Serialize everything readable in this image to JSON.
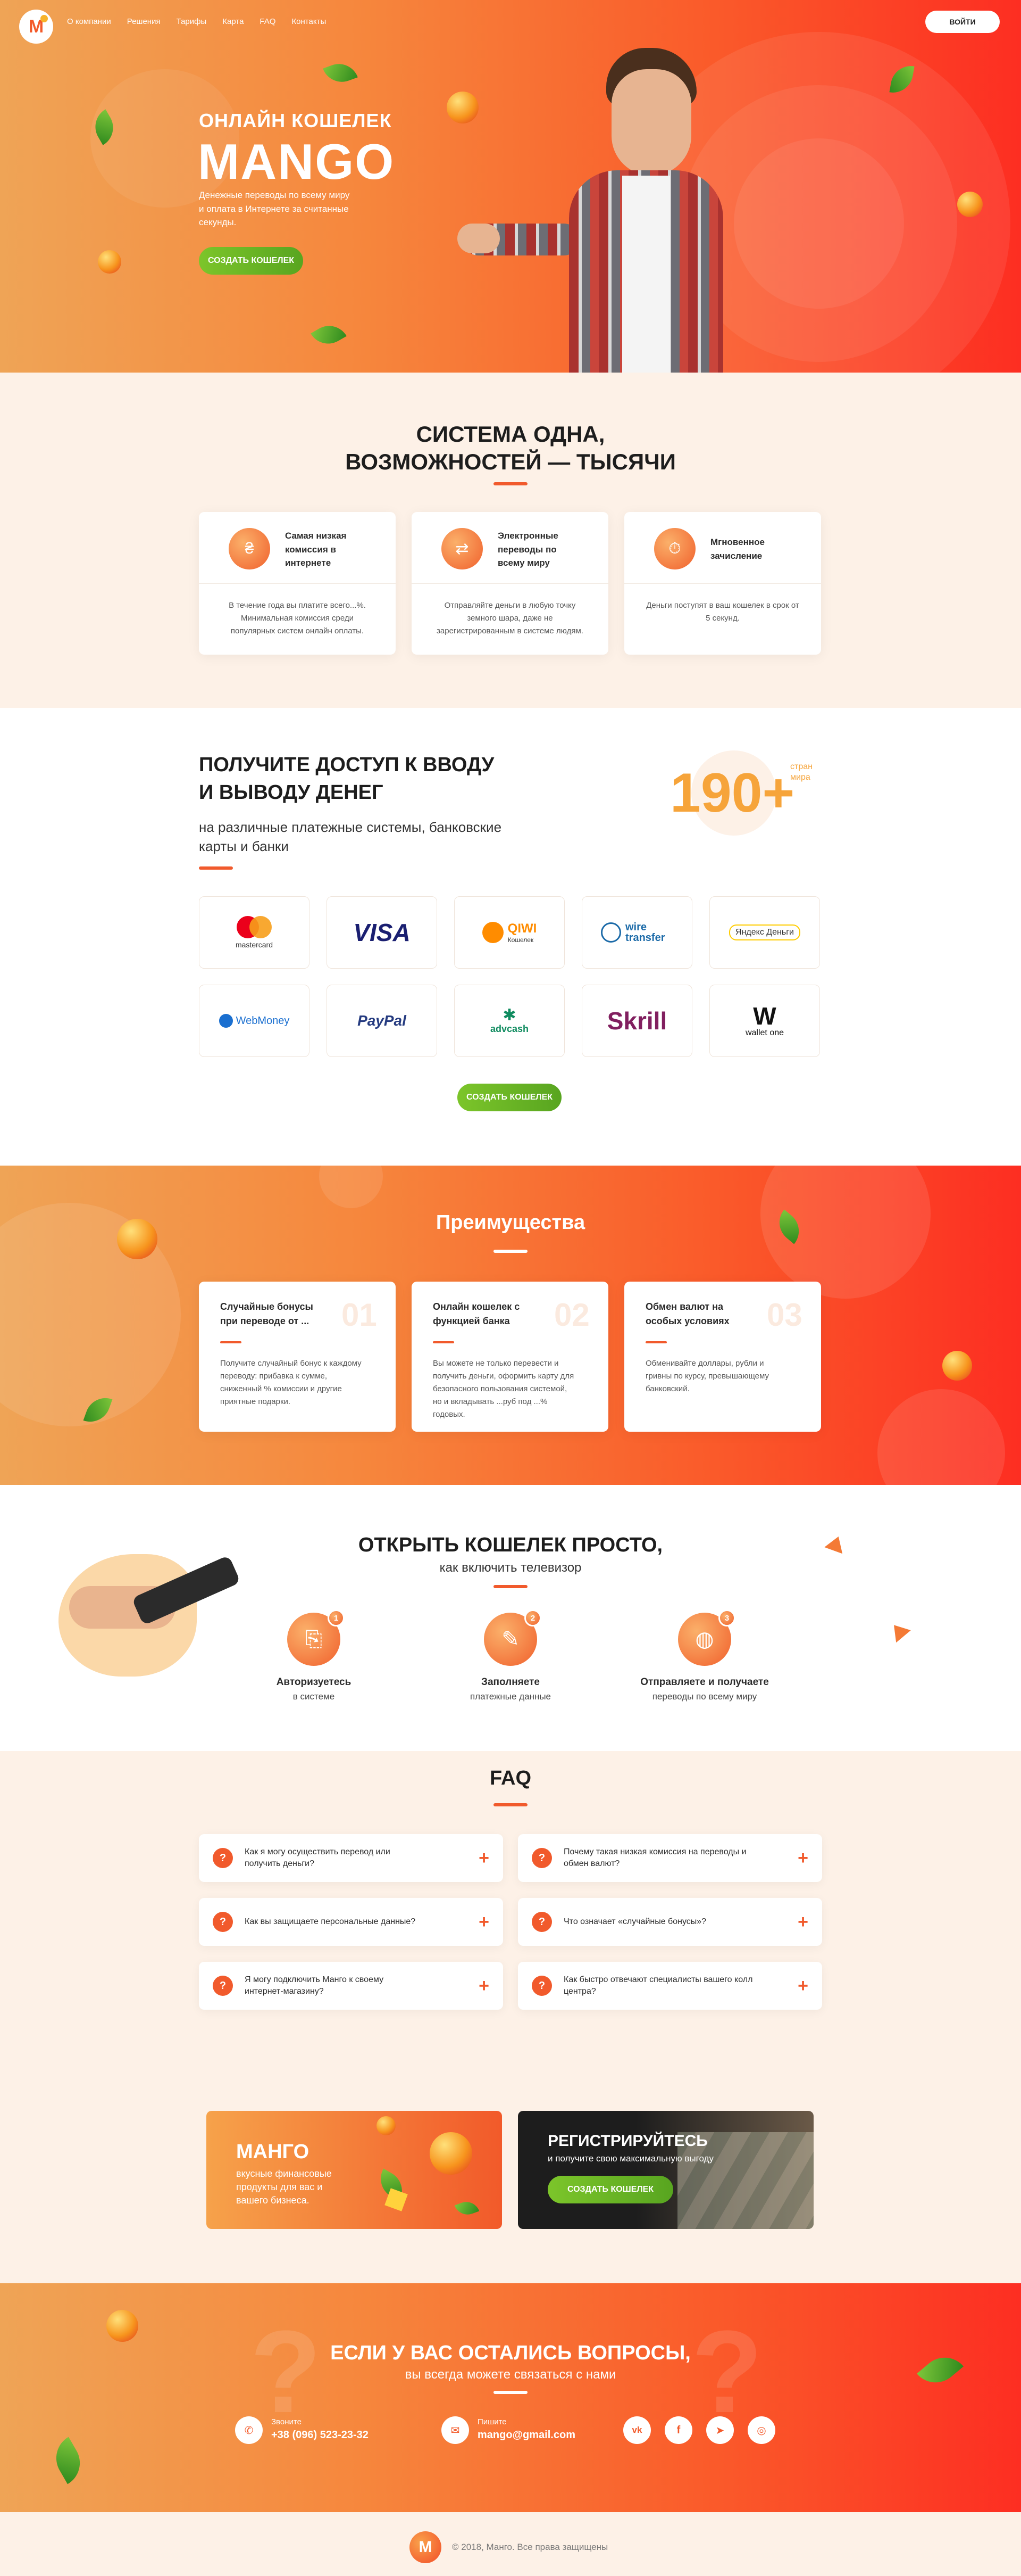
{
  "nav": {
    "items": [
      "О компании",
      "Решения",
      "Тарифы",
      "Карта",
      "FAQ",
      "Контакты"
    ],
    "login": "ВОЙТИ"
  },
  "hero": {
    "subtitle": "ОНЛАЙН КОШЕЛЕК",
    "title": "MANGO",
    "text": "Денежные переводы по всему миру и оплата в Интернете за считанные секунды.",
    "cta": "СОЗДАТЬ КОШЕЛЕК"
  },
  "system": {
    "title_line1": "СИСТЕМА ОДНА,",
    "title_line2": "ВОЗМОЖНОСТЕЙ — ТЫСЯЧИ",
    "cards": [
      {
        "title": "Самая низкая комиссия в интернете",
        "text": "В течение года вы платите всего...%. Минимальная комиссия среди популярных систем онлайн оплаты.",
        "icon": "hand-coin-icon"
      },
      {
        "title": "Электронные переводы по всему миру",
        "text": "Отправляйте деньги в любую точку земного шара, даже не зарегистрированным в системе людям.",
        "icon": "transfer-arrows-icon"
      },
      {
        "title": "Мгновенное зачисление",
        "text": "Деньги поступят в ваш кошелек в срок от 5 секунд.",
        "icon": "stopwatch-icon"
      }
    ]
  },
  "access": {
    "title_line1": "ПОЛУЧИТЕ ДОСТУП К ВВОДУ",
    "title_line2": "И ВЫВОДУ ДЕНЕГ",
    "subtitle": "на различные платежные системы, банковские карты и банки",
    "count": "190+",
    "count_label1": "стран",
    "count_label2": "мира",
    "cta": "СОЗДАТЬ КОШЕЛЕК",
    "logos": [
      "mastercard",
      "VISA",
      "QIWI",
      "wire transfer",
      "Яндекс Деньги",
      "WebMoney",
      "PayPal",
      "advcash",
      "Skrill",
      "wallet one"
    ],
    "qiwi_sub": "Кошелек"
  },
  "advantages": {
    "title": "Преимущества",
    "cards": [
      {
        "title": "Случайные бонусы при переводе от ...",
        "num": "01",
        "text": "Получите случайный бонус к каждому переводу: прибавка к сумме, сниженный % комиссии и другие приятные подарки."
      },
      {
        "title": "Онлайн кошелек с функцией банка",
        "num": "02",
        "text": "Вы можете не только перевести и получить деньги, оформить карту для безопасного пользования системой, но и вкладывать ...руб под ...% годовых."
      },
      {
        "title": "Обмен валют на особых условиях",
        "num": "03",
        "text": "Обменивайте доллары, рубли и гривны по курсу, превышающему банковский."
      }
    ]
  },
  "open": {
    "title": "ОТКРЫТЬ КОШЕЛЕК ПРОСТО,",
    "subtitle": "как включить телевизор",
    "steps": [
      {
        "num": "1",
        "title": "Авторизуетесь",
        "text": "в системе",
        "icon": "door-icon"
      },
      {
        "num": "2",
        "title": "Заполняете",
        "text": "платежные данные",
        "icon": "form-icon"
      },
      {
        "num": "3",
        "title": "Отправляете и получаете",
        "text": "переводы по всему миру",
        "icon": "globe-icon"
      }
    ]
  },
  "faq": {
    "title": "FAQ",
    "items": [
      "Как я могу осуществить перевод или получить деньги?",
      "Почему такая низкая комиссия на переводы и обмен валют?",
      "Как вы защищаете персональные данные?",
      "Что означает «случайные бонусы»?",
      "Я могу подключить Манго к своему интернет-магазину?",
      "Как быстро отвечают специалисты вашего колл центра?"
    ]
  },
  "promo": {
    "mango_title": "МАНГО",
    "mango_text": "вкусные финансовые продукты для вас и вашего бизнеса.",
    "reg_title": "РЕГИСТРИРУЙТЕСЬ",
    "reg_text": "и получите свою максимальную выгоду",
    "reg_cta": "СОЗДАТЬ КОШЕЛЕК"
  },
  "contact": {
    "title": "ЕСЛИ У ВАС ОСТАЛИСЬ ВОПРОСЫ,",
    "subtitle": "вы всегда можете связаться с нами",
    "call_label": "Звоните",
    "phone": "+38 (096) 523-23-32",
    "write_label": "Пишите",
    "email": "mango@gmail.com",
    "socials": [
      "vk",
      "facebook",
      "telegram",
      "instagram"
    ]
  },
  "footer": {
    "text": "© 2018, Манго. Все права защищены"
  },
  "colors": {
    "accent": "#f15a2c",
    "green": "#6ab827",
    "bg": "#fdf1e7"
  }
}
